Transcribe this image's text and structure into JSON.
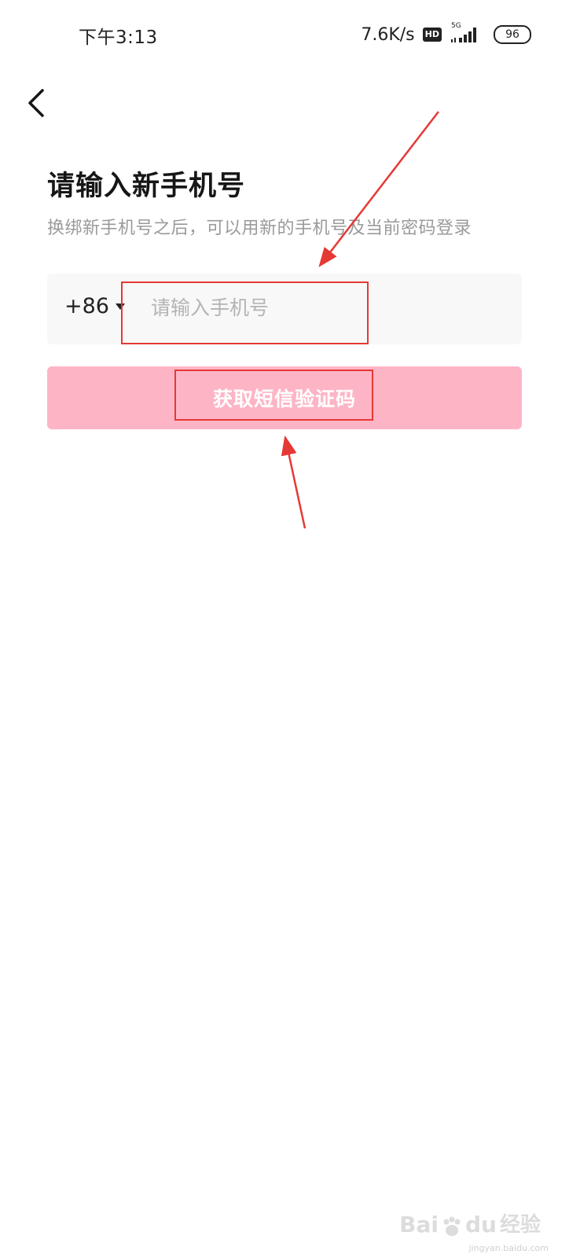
{
  "status_bar": {
    "time": "下午3:13",
    "net_speed": "7.6K/s",
    "hd_badge": "HD",
    "network_type": "5G",
    "battery": "96"
  },
  "header": {
    "back_icon": "chevron-left-icon"
  },
  "main": {
    "title": "请输入新手机号",
    "subtitle": "换绑新手机号之后，可以用新的手机号及当前密码登录",
    "country_code": "+86",
    "phone_placeholder": "请输入手机号",
    "phone_value": "",
    "get_code_label": "获取短信验证码"
  },
  "watermark": {
    "logo": "Bai",
    "logo2": "du",
    "jingyan": "经验",
    "url": "jingyan.baidu.com"
  },
  "colors": {
    "button_bg": "#fdb5c6",
    "annotation": "#e53935",
    "input_bg": "#f8f8f8"
  }
}
